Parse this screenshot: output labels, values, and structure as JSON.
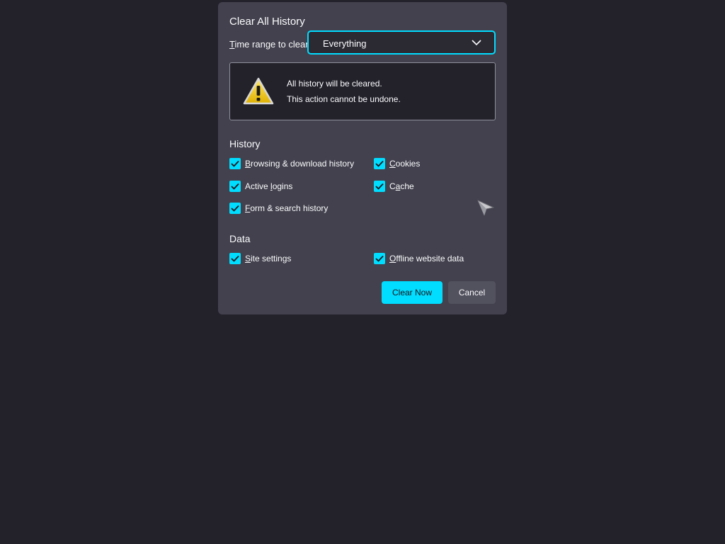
{
  "dialog": {
    "title": "Clear All History",
    "time_range": {
      "label_accesskey": "T",
      "label_rest": "ime range to clear:",
      "selected": "Everything"
    },
    "warning": {
      "icon": "warning-icon",
      "line1": "All history will be cleared.",
      "line2": "This action cannot be undone."
    },
    "history": {
      "title": "History",
      "items": [
        {
          "ak": "B",
          "rest": "rowsing & download history",
          "checked": true
        },
        {
          "ak": "C",
          "rest": "ookies",
          "checked": true
        },
        {
          "ak": "",
          "rest": "Active ",
          "ak2": "l",
          "rest2": "ogins",
          "checked": true
        },
        {
          "ak": "",
          "rest": "C",
          "ak2": "a",
          "rest2": "che",
          "checked": true
        },
        {
          "ak": "F",
          "rest": "orm & search history",
          "checked": true
        }
      ]
    },
    "data": {
      "title": "Data",
      "items": [
        {
          "ak": "S",
          "rest": "ite settings",
          "checked": true
        },
        {
          "ak": "O",
          "rest": "ffline website data",
          "checked": true
        }
      ]
    },
    "buttons": {
      "clear_now": "Clear Now",
      "cancel": "Cancel"
    }
  },
  "colors": {
    "accent": "#00ddff",
    "dialog_bg": "#42414d",
    "page_bg": "#23222b"
  }
}
